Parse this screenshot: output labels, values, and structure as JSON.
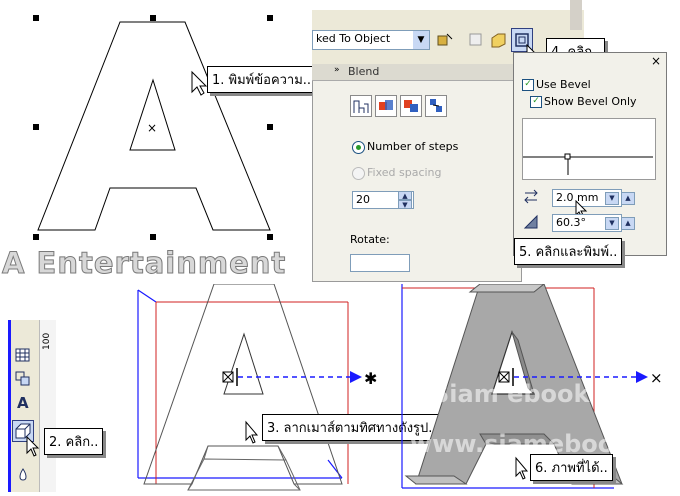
{
  "top_left_panel": {
    "callout_1": "1. พิมพ์ข้อความ..",
    "watermark_text": "A Entertainment"
  },
  "toolbar": {
    "dropdown_value": "ked To Object",
    "callout_4": "4. คลิก.."
  },
  "blend_panel": {
    "title": "Blend",
    "number_of_steps_label": "Number of steps",
    "fixed_spacing_label": "Fixed spacing",
    "steps_value": "20",
    "rotate_label": "Rotate:"
  },
  "bevel_popup": {
    "use_bevel_label": "Use Bevel",
    "show_bevel_only_label": "Show Bevel Only",
    "close_glyph": "×",
    "depth_value": "2.0 mm",
    "angle_value": "60.3°",
    "callout_5": "5. คลิกและพิมพ์.."
  },
  "bottom_left": {
    "ruler_value": "100",
    "callout_2": "2. คลิก.."
  },
  "bottom_middle": {
    "callout_3": "3. ลากเมาส์ตามทิศทางดังรูป.."
  },
  "bottom_right": {
    "watermark_1": "Siam ebook",
    "watermark_2": "www.siamebook.com",
    "callout_6": "6. ภาพที่ได้.."
  },
  "colors": {
    "blue_line": "#1a1aff",
    "red_line": "#d02020",
    "extrude_fill": "#a8a8a8",
    "panel_bg": "#f2f1ea",
    "selected_button": "#c8d8f4"
  }
}
